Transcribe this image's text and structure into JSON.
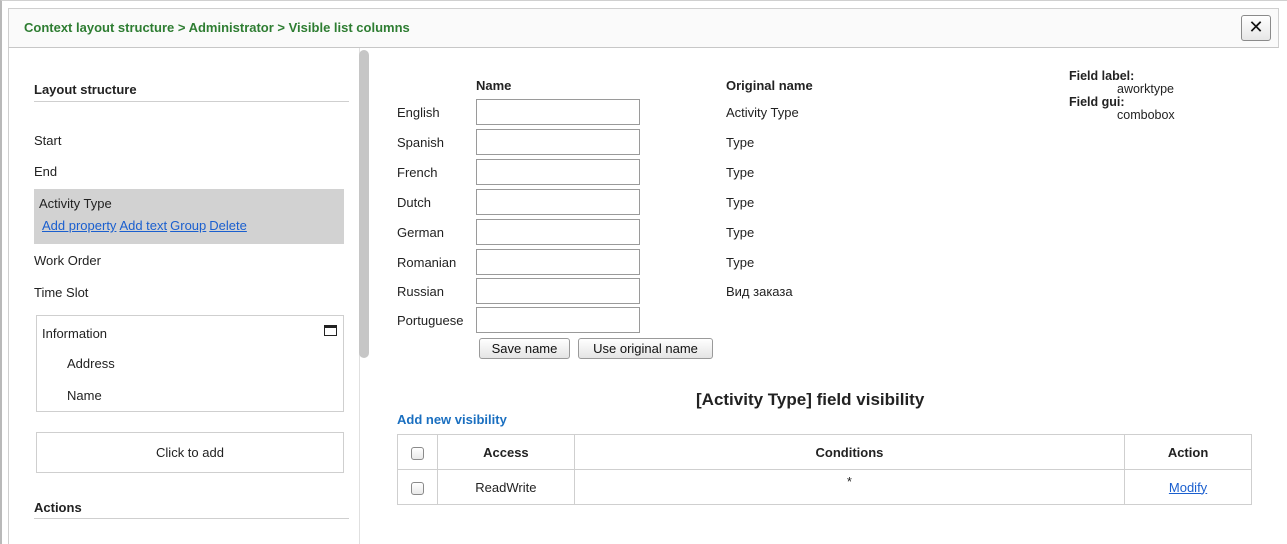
{
  "breadcrumb": "Context layout structure > Administrator > Visible list columns",
  "close_label": "✕",
  "layout": {
    "title": "Layout structure",
    "items": [
      "Start",
      "End"
    ],
    "active_item": {
      "label": "Activity Type",
      "links": [
        "Add property",
        "Add text",
        "Group",
        "Delete"
      ]
    },
    "after_items": [
      "Work Order",
      "Time Slot"
    ],
    "group": {
      "title": "Information",
      "items": [
        "Address",
        "Name"
      ]
    },
    "add_label": "Click to add",
    "actions_title": "Actions"
  },
  "names": {
    "name_header": "Name",
    "original_header": "Original name",
    "rows": [
      {
        "lang": "English",
        "value": "",
        "original": "Activity Type"
      },
      {
        "lang": "Spanish",
        "value": "",
        "original": "Type"
      },
      {
        "lang": "French",
        "value": "",
        "original": "Type"
      },
      {
        "lang": "Dutch",
        "value": "",
        "original": "Type"
      },
      {
        "lang": "German",
        "value": "",
        "original": "Type"
      },
      {
        "lang": "Romanian",
        "value": "",
        "original": "Type"
      },
      {
        "lang": "Russian",
        "value": "",
        "original": "Вид заказа"
      },
      {
        "lang": "Portuguese",
        "value": "",
        "original": ""
      }
    ],
    "save_button": "Save name",
    "use_original_button": "Use original name"
  },
  "field": {
    "label_key": "Field label:",
    "label_value": "aworktype",
    "gui_key": "Field gui:",
    "gui_value": "combobox"
  },
  "visibility": {
    "title": "[Activity Type] field visibility",
    "add_link": "Add new visibility",
    "headers": {
      "access": "Access",
      "conditions": "Conditions",
      "action": "Action"
    },
    "rows": [
      {
        "access": "ReadWrite",
        "conditions": "*",
        "action": "Modify"
      }
    ]
  }
}
